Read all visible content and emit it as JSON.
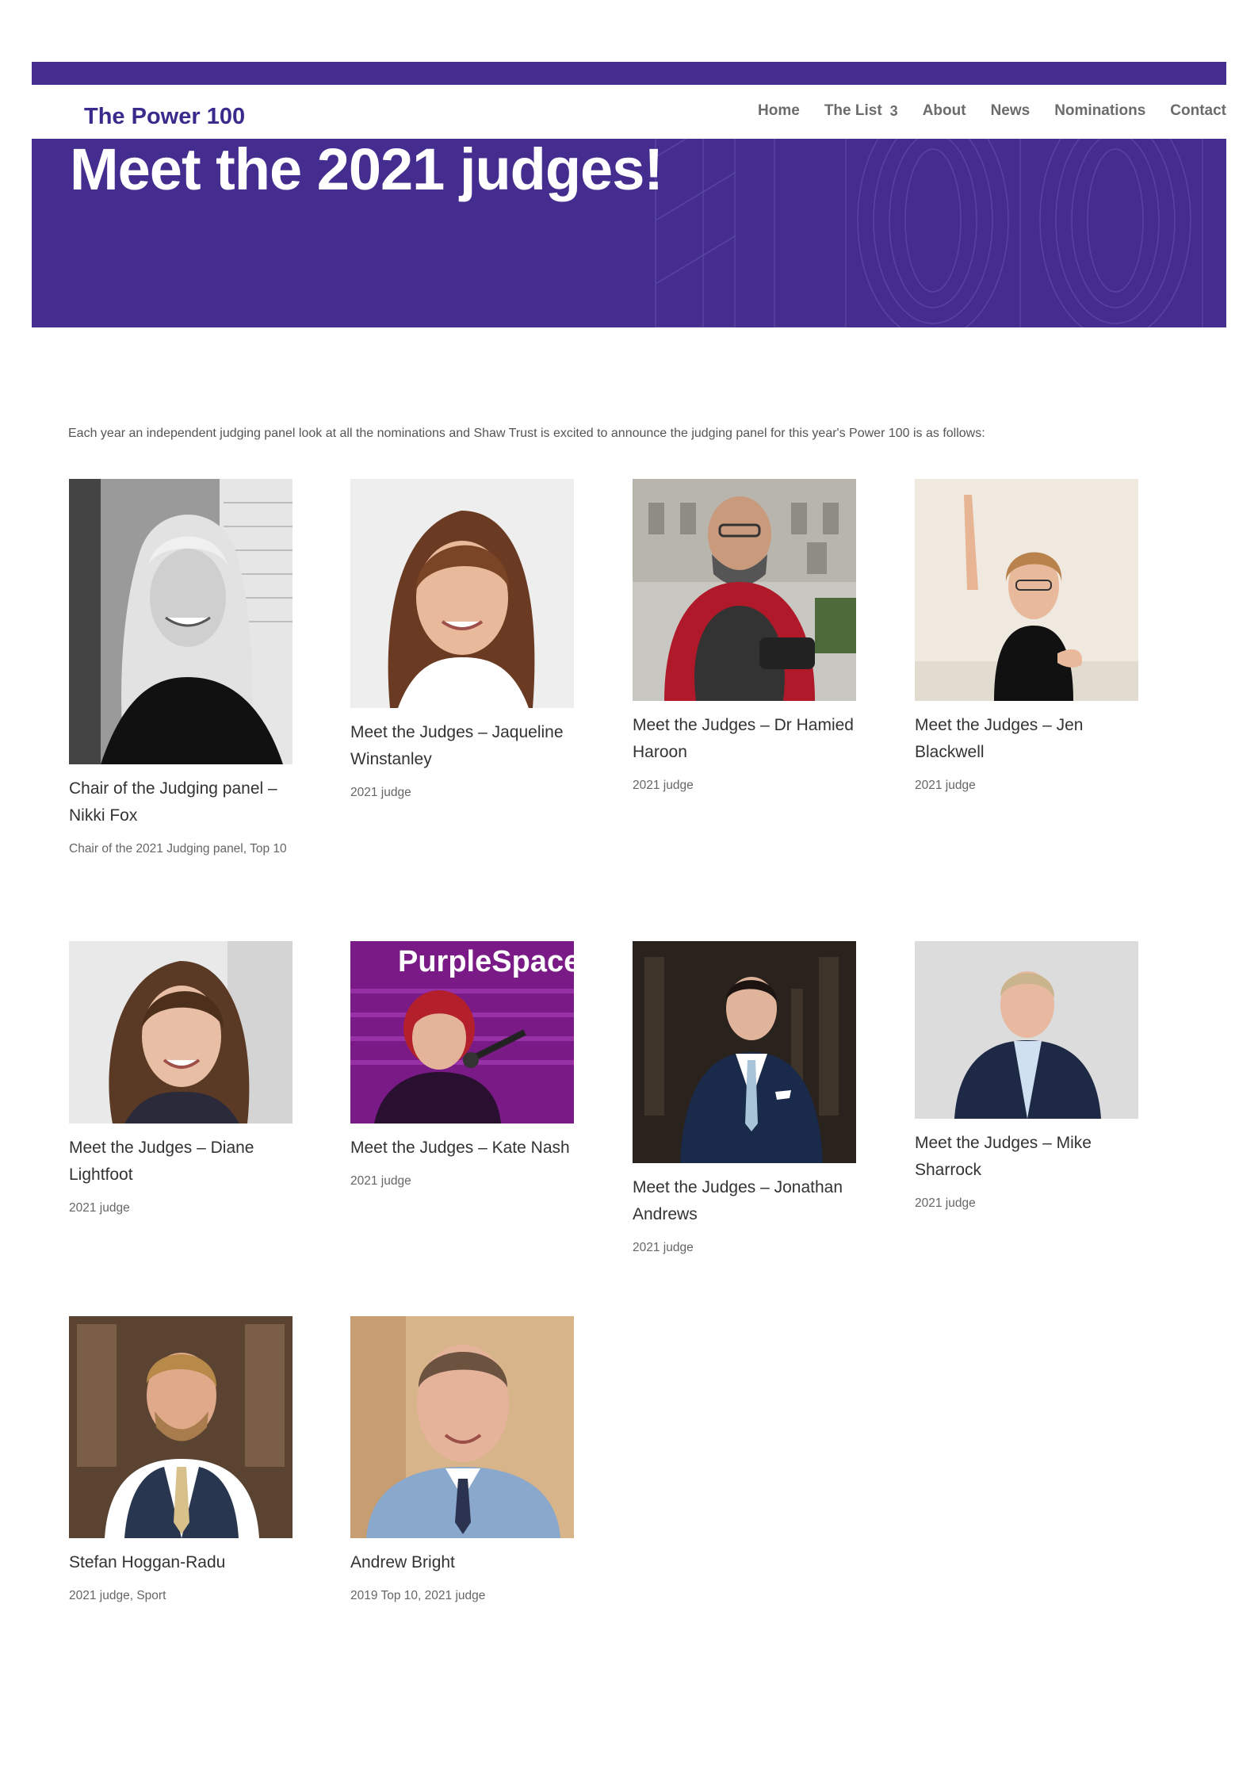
{
  "site": {
    "logo": "The Power 100",
    "menu": [
      {
        "label": "Home"
      },
      {
        "label": "The List",
        "badge": "3"
      },
      {
        "label": "About"
      },
      {
        "label": "News"
      },
      {
        "label": "Nominations"
      },
      {
        "label": "Contact"
      }
    ]
  },
  "hero": {
    "title": "Meet the 2021 judges!"
  },
  "intro": "Each year an independent judging panel look at all the nominations and Shaw Trust is excited to announce the judging panel for this year's Power 100 is as follows:",
  "judges": [
    {
      "title": "Chair of the Judging panel – Nikki Fox",
      "category": "Chair of the 2021 Judging panel, Top 10"
    },
    {
      "title": "Meet the Judges – Jaqueline Winstanley",
      "category": "2021 judge"
    },
    {
      "title": "Meet the Judges – Dr Hamied Haroon",
      "category": "2021 judge"
    },
    {
      "title": "Meet the Judges – Jen Blackwell",
      "category": "2021 judge"
    },
    {
      "title": "Meet the Judges – Diane Lightfoot",
      "category": "2021 judge"
    },
    {
      "title": "Meet the Judges – Kate Nash",
      "category": "2021 judge",
      "photo_text": "PurpleSpace"
    },
    {
      "title": "Meet the Judges – Jonathan Andrews",
      "category": "2021 judge"
    },
    {
      "title": "Meet the Judges – Mike Sharrock",
      "category": "2021 judge"
    },
    {
      "title": "Stefan Hoggan-Radu",
      "category": "2021 judge, Sport"
    },
    {
      "title": "Andrew Bright",
      "category": "2019 Top 10, 2021 judge"
    }
  ],
  "colors": {
    "brand_purple": "#452d8f",
    "logo_purple": "#3a2a8c"
  }
}
